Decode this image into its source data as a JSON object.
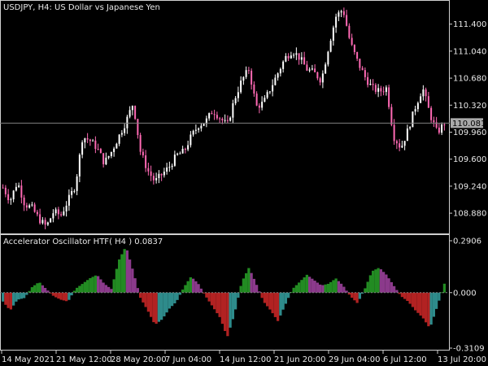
{
  "window": {
    "symbol_header": "USDJPY, H4:  US Dollar vs Japanese Yen"
  },
  "price_axis": {
    "labels": [
      "111.400",
      "111.040",
      "110.680",
      "110.320",
      "109.960",
      "109.600",
      "109.240",
      "108.880"
    ],
    "values": [
      111.4,
      111.04,
      110.68,
      110.32,
      109.96,
      109.6,
      109.24,
      108.88
    ],
    "range": [
      108.61,
      111.7
    ],
    "current_price_label": "110.081",
    "current_price": 110.081
  },
  "indicator": {
    "title": "Accelerator Oscillator HTF( H4 ) 0.0837",
    "axis_labels": [
      "0.2906",
      "0.000",
      "-0.3109"
    ],
    "axis_values": [
      0.2906,
      0.0,
      -0.3109
    ]
  },
  "time_axis": {
    "labels": [
      "14 May 2021",
      "21 May 12:00",
      "28 May 20:00",
      "7 Jun 04:00",
      "14 Jun 12:00",
      "21 Jun 20:00",
      "29 Jun 04:00",
      "6 Jul 12:00",
      "13 Jul 20:00"
    ]
  },
  "colors": {
    "background": "#000000",
    "bull_candle": "#ffffff",
    "bear_candle": "#ff69b4",
    "grid": "#808080",
    "osc_green": "#228b22",
    "osc_teal": "#2e8b8b",
    "osc_red": "#b22222",
    "osc_purple": "#8b3a8b",
    "price_box": "#a9a9a9"
  },
  "chart_data": {
    "type": "candlestick",
    "close_path": [
      109.22,
      109.05,
      109.3,
      109.0,
      108.95,
      108.8,
      108.7,
      108.9,
      108.85,
      109.05,
      109.25,
      109.9,
      109.85,
      109.75,
      109.55,
      109.7,
      109.9,
      110.1,
      110.35,
      109.7,
      109.45,
      109.3,
      109.4,
      109.5,
      109.65,
      109.7,
      109.9,
      110.05,
      110.1,
      110.25,
      110.15,
      110.05,
      110.4,
      110.65,
      110.8,
      110.3,
      110.35,
      110.55,
      110.75,
      110.95,
      111.05,
      110.95,
      110.8,
      110.75,
      110.65,
      111.1,
      111.5,
      111.6,
      111.15,
      110.9,
      110.7,
      110.55,
      110.5,
      110.55,
      109.9,
      109.75,
      110.0,
      110.3,
      110.55,
      110.2,
      109.95,
      110.08
    ],
    "oscillator": [
      -0.05,
      -0.1,
      -0.04,
      -0.03,
      0.03,
      0.06,
      0.02,
      -0.02,
      -0.04,
      -0.05,
      0.02,
      0.05,
      0.08,
      0.1,
      0.05,
      0.02,
      0.18,
      0.26,
      0.12,
      -0.03,
      -0.1,
      -0.18,
      -0.15,
      -0.09,
      -0.05,
      0.03,
      0.09,
      0.05,
      -0.02,
      -0.08,
      -0.14,
      -0.25,
      -0.12,
      0.06,
      0.14,
      0.05,
      -0.05,
      -0.1,
      -0.16,
      -0.07,
      0.02,
      0.06,
      0.1,
      0.07,
      0.04,
      0.05,
      0.08,
      0.04,
      -0.02,
      -0.06,
      0.02,
      0.12,
      0.14,
      0.1,
      0.04,
      -0.02,
      -0.05,
      -0.1,
      -0.14,
      -0.2,
      -0.08,
      0.05
    ]
  }
}
